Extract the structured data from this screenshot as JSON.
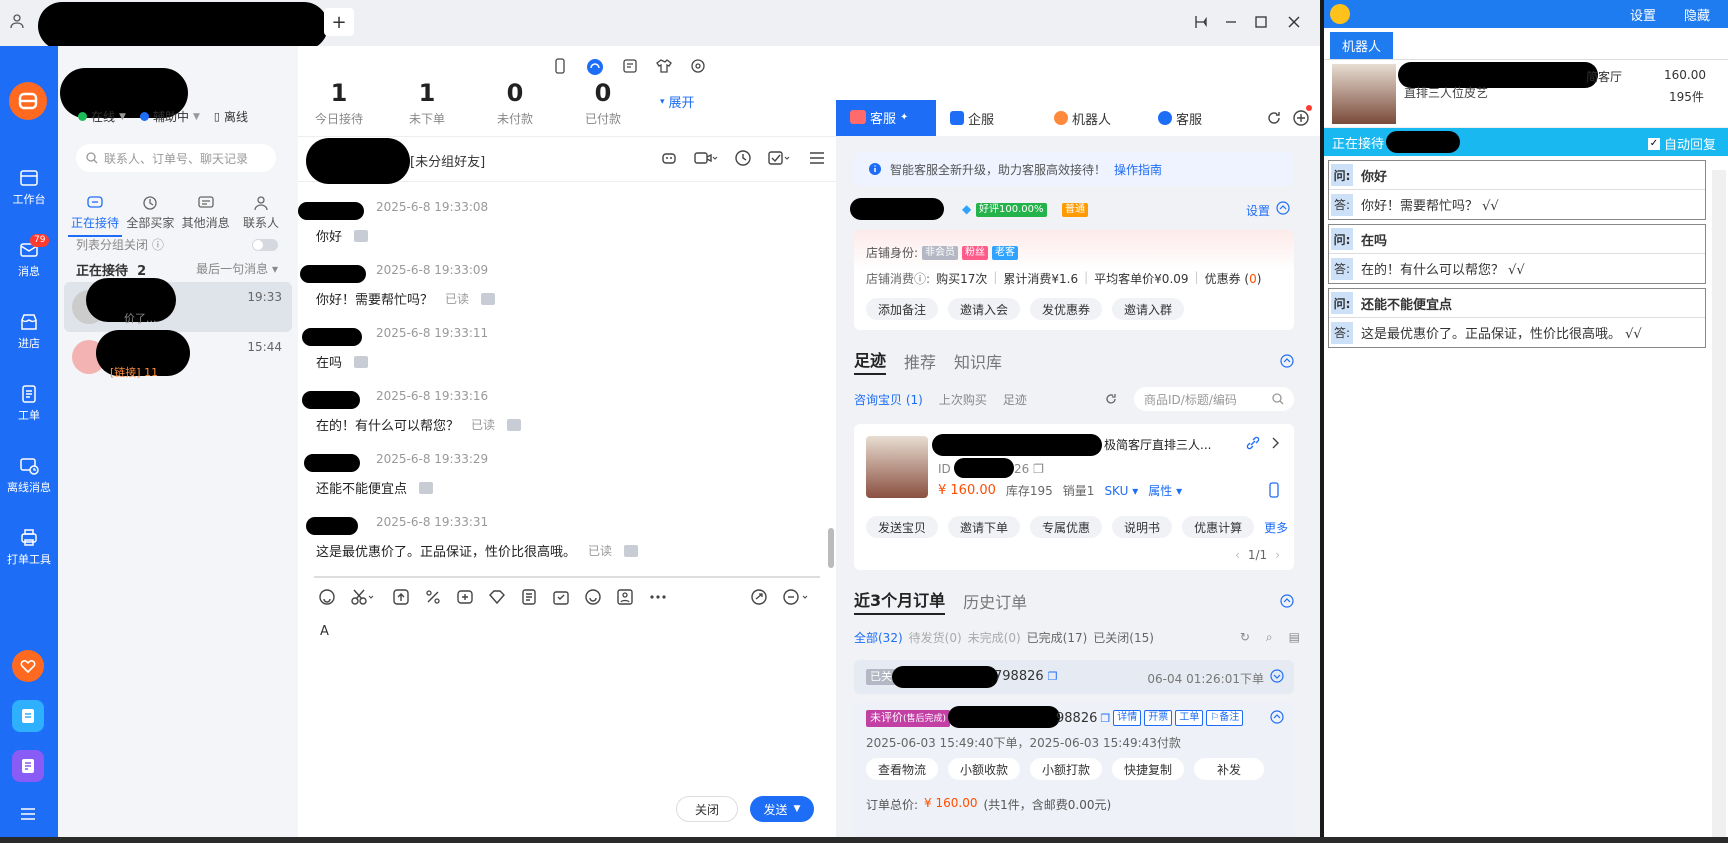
{
  "topbar": {
    "plus": "+"
  },
  "nav": {
    "items": [
      {
        "label": "工作台",
        "icon": "dashboard-icon"
      },
      {
        "label": "消息",
        "icon": "message-icon",
        "badge": "79"
      },
      {
        "label": "进店",
        "icon": "store-icon"
      },
      {
        "label": "工单",
        "icon": "ticket-icon"
      },
      {
        "label": "离线消息",
        "icon": "offline-message-icon"
      },
      {
        "label": "打单工具",
        "icon": "print-icon"
      }
    ]
  },
  "contacts": {
    "status_online": "在线",
    "status_assist": "辅助中",
    "status_offline": "离线",
    "search_placeholder": "联系人、订单号、聊天记录",
    "tabs": [
      "正在接待",
      "全部买家",
      "其他消息",
      "联系人"
    ],
    "group_toggle": "列表分组关闭",
    "receiving_label": "正在接待",
    "receiving_count": "2",
    "sort_label": "最后一句消息",
    "conversations": [
      {
        "time": "19:33",
        "preview": "价了..."
      },
      {
        "time": "15:44",
        "preview": "[链接] 11"
      }
    ]
  },
  "stats": [
    {
      "num": "1",
      "label": "今日接待"
    },
    {
      "num": "1",
      "label": "未下单"
    },
    {
      "num": "0",
      "label": "未付款"
    },
    {
      "num": "0",
      "label": "已付款"
    }
  ],
  "expand_label": "展开",
  "chat": {
    "group": "[未分组好友]",
    "read_label": "已读",
    "messages": [
      {
        "time": "2025-6-8 19:33:08",
        "text": "你好",
        "read": false
      },
      {
        "time": "2025-6-8 19:33:09",
        "text": "你好！需要帮忙吗？",
        "read": true
      },
      {
        "time": "2025-6-8 19:33:11",
        "text": "在吗",
        "read": false
      },
      {
        "time": "2025-6-8 19:33:16",
        "text": "在的！有什么可以帮您？",
        "read": true
      },
      {
        "time": "2025-6-8 19:33:29",
        "text": "还能不能便宜点",
        "read": false
      },
      {
        "time": "2025-6-8 19:33:31",
        "text": "这是最优惠价了。正品保证，性价比很高哦。",
        "read": true
      }
    ],
    "input_value": "A",
    "close_label": "关闭",
    "send_label": "发送"
  },
  "panel": {
    "tabs": [
      "客服",
      "企服",
      "机器人",
      "客服"
    ],
    "notice": "智能客服全新升级，助力客服高效接待！",
    "notice_link": "操作指南",
    "rating": "好评100.00%",
    "level": "普通",
    "settings_label": "设置",
    "identity_label": "店铺身份:",
    "identity_tags": [
      "非会员",
      "粉丝",
      "老客"
    ],
    "consume_label": "店铺消费",
    "consume_parts": [
      "购买17次",
      "累计消费¥1.6",
      "平均客单价¥0.09",
      "优惠券 ("
    ],
    "coupon_count": "0",
    "consume_close": ")",
    "actions": [
      "添加备注",
      "邀请入会",
      "发优惠券",
      "邀请入群"
    ],
    "footprint_tabs": [
      "足迹",
      "推荐",
      "知识库"
    ],
    "sub_tabs": [
      "咨询宝贝 (1)",
      "上次购买",
      "足迹"
    ],
    "product_search_placeholder": "商品ID/标题/编码",
    "product": {
      "title": "极简客厅直排三人...",
      "id_prefix": "ID",
      "id_suffix": "26",
      "price": "¥ 160.00",
      "stock": "库存195",
      "sales": "销量1",
      "sku": "SKU",
      "attr": "属性"
    },
    "product_actions": [
      "发送宝贝",
      "邀请下单",
      "专属优惠",
      "说明书",
      "优惠计算"
    ],
    "more": "更多",
    "pager": "1/1",
    "order_tabs": [
      "近3个月订单",
      "历史订单"
    ],
    "order_filters": [
      "全部(32)",
      "待发货(0)",
      "未完成(0)",
      "已完成(17)",
      "已关闭(15)"
    ],
    "order1": {
      "status": "已关",
      "id": "798826",
      "time": "06-04 01:26:01下单"
    },
    "order2": {
      "status": "未评价",
      "status_sub": "(售后完成)",
      "id": "98826",
      "tags": [
        "详情",
        "开票",
        "工单",
        "备注"
      ],
      "times": "2025-06-03 15:49:40下单，2025-06-03 15:49:43付款",
      "actions": [
        "查看物流",
        "小额收款",
        "小额打款",
        "快捷复制",
        "补发"
      ],
      "total_label": "订单总价:",
      "total": "¥ 160.00",
      "total_extra": "(共1件，含邮费0.00元)"
    }
  },
  "robot": {
    "settings": "设置",
    "hide": "隐藏",
    "tab": "机器人",
    "product_title_a": "简客厅",
    "product_title_b": "直排三人位皮艺",
    "price": "160.00",
    "count": "195件",
    "status": "正在接待",
    "auto_reply": "自动回复",
    "q_key": "问:",
    "a_key": "答:",
    "qa": [
      {
        "q": "你好",
        "a": "你好！需要帮忙吗？ √√"
      },
      {
        "q": "在吗",
        "a": "在的！有什么可以帮您？ √√"
      },
      {
        "q": "还能不能便宜点",
        "a": "这是最优惠价了。正品保证，性价比很高哦。 √√"
      }
    ]
  }
}
